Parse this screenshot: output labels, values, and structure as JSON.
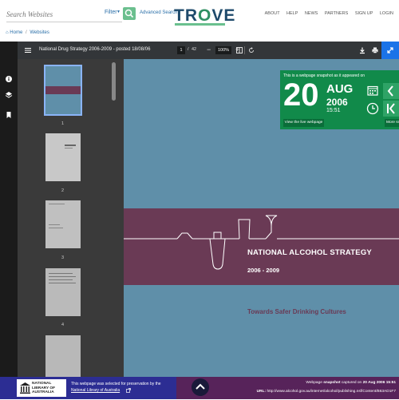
{
  "header": {
    "search_placeholder": "Search Websites",
    "filter_label": "Filter",
    "advanced_search": "Advanced Search",
    "logo_prefix": "TR",
    "logo_o": "O",
    "logo_suffix": "VE",
    "nav": [
      "ABOUT",
      "HELP",
      "NEWS",
      "PARTNERS",
      "SIGN UP",
      "LOGIN"
    ]
  },
  "breadcrumb": {
    "home": "Home",
    "current": "Websites"
  },
  "pdf": {
    "title": "National Drug Strategy 2006-2009 - posted 18/08/06",
    "page_current": "1",
    "page_total": "42",
    "zoom": "100%",
    "thumbnails": [
      "1",
      "2",
      "3",
      "4"
    ]
  },
  "document": {
    "title": "NATIONAL ALCOHOL STRATEGY",
    "years": "2006 - 2009",
    "subtitle": "Towards Safer Drinking Cultures"
  },
  "snapshot": {
    "line": "This is a webpage snapshot as it appeared on",
    "day": "20",
    "month": "AUG",
    "year": "2006",
    "time": "15:51",
    "live_button": "View the live webpage",
    "more_button": "More sn"
  },
  "footer": {
    "nla_logo_text": "NATIONAL LIBRARY OF AUSTRALIA",
    "selected_line": "This webpage was selected for preservation by the",
    "library_link": "National Library of Australia",
    "captured_prefix": "Webpage",
    "captured_word": "snapshot",
    "captured_middle": "captured on",
    "captured_date": "20 Aug 2006 15:51",
    "url_label": "URL:",
    "url": "http://www.alcohol.gov.au/internet/alcohol/publishing.nsf/Content/B63AD1F7"
  },
  "colors": {
    "accent_green": "#118a4a",
    "doc_blue": "#5f8fa9",
    "doc_plum": "#6a3a55",
    "footer_blue": "#2c2d93",
    "footer_plum": "#57235a"
  }
}
